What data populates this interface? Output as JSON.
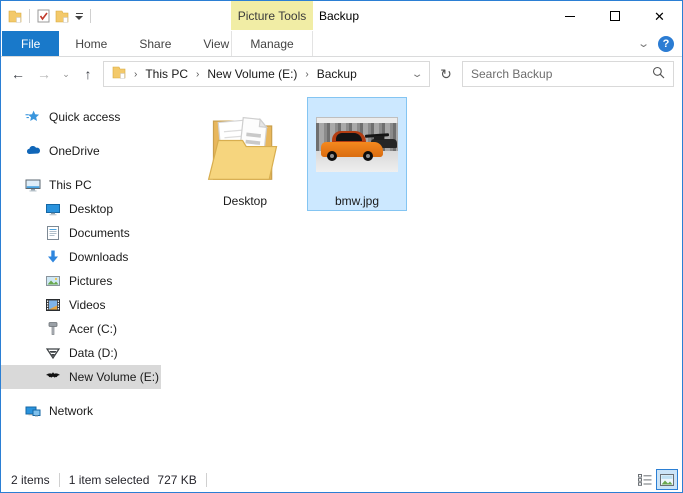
{
  "titlebar": {
    "title": "Backup",
    "contextual_group": "Picture Tools"
  },
  "ribbon": {
    "tabs": [
      {
        "label": "File",
        "active": true
      },
      {
        "label": "Home",
        "active": false
      },
      {
        "label": "Share",
        "active": false
      },
      {
        "label": "View",
        "active": false
      },
      {
        "label": "Manage",
        "active": false,
        "contextual": true
      }
    ],
    "help_label": "?"
  },
  "address": {
    "breadcrumb": [
      "This PC",
      "New Volume (E:)",
      "Backup"
    ]
  },
  "search": {
    "placeholder": "Search Backup",
    "value": ""
  },
  "sidebar": {
    "items": [
      {
        "label": "Quick access",
        "icon": "quick-access-star-icon",
        "indent": 0,
        "selected": false
      },
      {
        "label": "OneDrive",
        "icon": "onedrive-cloud-icon",
        "indent": 0,
        "selected": false
      },
      {
        "label": "This PC",
        "icon": "computer-icon",
        "indent": 0,
        "selected": false
      },
      {
        "label": "Desktop",
        "icon": "desktop-icon",
        "indent": 1,
        "selected": false
      },
      {
        "label": "Documents",
        "icon": "document-icon",
        "indent": 1,
        "selected": false
      },
      {
        "label": "Downloads",
        "icon": "download-arrow-icon",
        "indent": 1,
        "selected": false
      },
      {
        "label": "Pictures",
        "icon": "picture-icon",
        "indent": 1,
        "selected": false
      },
      {
        "label": "Videos",
        "icon": "video-film-icon",
        "indent": 1,
        "selected": false
      },
      {
        "label": "Acer (C:)",
        "icon": "drive-c-hammer-icon",
        "indent": 1,
        "selected": false
      },
      {
        "label": "Data (D:)",
        "icon": "drive-d-shield-icon",
        "indent": 1,
        "selected": false
      },
      {
        "label": "New Volume (E:)",
        "icon": "drive-e-bat-icon",
        "indent": 1,
        "selected": true
      },
      {
        "label": "Network",
        "icon": "network-icon",
        "indent": 0,
        "selected": false
      }
    ]
  },
  "files": [
    {
      "name": "Desktop",
      "type": "folder",
      "selected": false
    },
    {
      "name": "bmw.jpg",
      "type": "image",
      "selected": true
    }
  ],
  "statusbar": {
    "count": "2 items",
    "selection": "1 item selected",
    "size": "727 KB"
  },
  "colors": {
    "accent_border": "#2b7fd4",
    "file_tab": "#1979ca",
    "contextual_tab_bg": "#f1eda5",
    "selection_bg": "#cce8ff",
    "selection_border": "#84c5f2",
    "sidebar_selected": "#d9d9d9",
    "folder_yellow": "#f3c96a",
    "car_orange": "#f5891e"
  }
}
